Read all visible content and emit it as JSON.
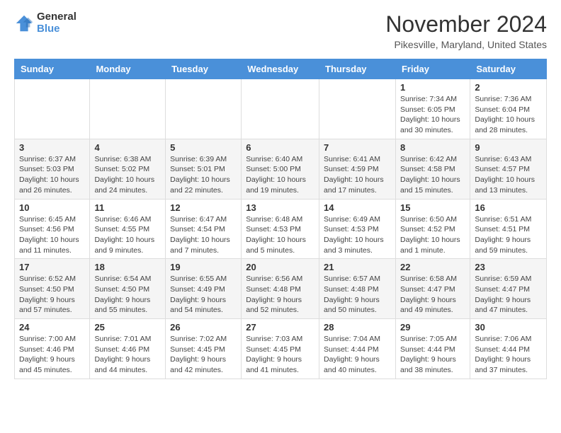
{
  "header": {
    "logo_general": "General",
    "logo_blue": "Blue",
    "month_title": "November 2024",
    "location": "Pikesville, Maryland, United States"
  },
  "days_of_week": [
    "Sunday",
    "Monday",
    "Tuesday",
    "Wednesday",
    "Thursday",
    "Friday",
    "Saturday"
  ],
  "weeks": [
    [
      {
        "day": "",
        "info": ""
      },
      {
        "day": "",
        "info": ""
      },
      {
        "day": "",
        "info": ""
      },
      {
        "day": "",
        "info": ""
      },
      {
        "day": "",
        "info": ""
      },
      {
        "day": "1",
        "info": "Sunrise: 7:34 AM\nSunset: 6:05 PM\nDaylight: 10 hours and 30 minutes."
      },
      {
        "day": "2",
        "info": "Sunrise: 7:36 AM\nSunset: 6:04 PM\nDaylight: 10 hours and 28 minutes."
      }
    ],
    [
      {
        "day": "3",
        "info": "Sunrise: 6:37 AM\nSunset: 5:03 PM\nDaylight: 10 hours and 26 minutes."
      },
      {
        "day": "4",
        "info": "Sunrise: 6:38 AM\nSunset: 5:02 PM\nDaylight: 10 hours and 24 minutes."
      },
      {
        "day": "5",
        "info": "Sunrise: 6:39 AM\nSunset: 5:01 PM\nDaylight: 10 hours and 22 minutes."
      },
      {
        "day": "6",
        "info": "Sunrise: 6:40 AM\nSunset: 5:00 PM\nDaylight: 10 hours and 19 minutes."
      },
      {
        "day": "7",
        "info": "Sunrise: 6:41 AM\nSunset: 4:59 PM\nDaylight: 10 hours and 17 minutes."
      },
      {
        "day": "8",
        "info": "Sunrise: 6:42 AM\nSunset: 4:58 PM\nDaylight: 10 hours and 15 minutes."
      },
      {
        "day": "9",
        "info": "Sunrise: 6:43 AM\nSunset: 4:57 PM\nDaylight: 10 hours and 13 minutes."
      }
    ],
    [
      {
        "day": "10",
        "info": "Sunrise: 6:45 AM\nSunset: 4:56 PM\nDaylight: 10 hours and 11 minutes."
      },
      {
        "day": "11",
        "info": "Sunrise: 6:46 AM\nSunset: 4:55 PM\nDaylight: 10 hours and 9 minutes."
      },
      {
        "day": "12",
        "info": "Sunrise: 6:47 AM\nSunset: 4:54 PM\nDaylight: 10 hours and 7 minutes."
      },
      {
        "day": "13",
        "info": "Sunrise: 6:48 AM\nSunset: 4:53 PM\nDaylight: 10 hours and 5 minutes."
      },
      {
        "day": "14",
        "info": "Sunrise: 6:49 AM\nSunset: 4:53 PM\nDaylight: 10 hours and 3 minutes."
      },
      {
        "day": "15",
        "info": "Sunrise: 6:50 AM\nSunset: 4:52 PM\nDaylight: 10 hours and 1 minute."
      },
      {
        "day": "16",
        "info": "Sunrise: 6:51 AM\nSunset: 4:51 PM\nDaylight: 9 hours and 59 minutes."
      }
    ],
    [
      {
        "day": "17",
        "info": "Sunrise: 6:52 AM\nSunset: 4:50 PM\nDaylight: 9 hours and 57 minutes."
      },
      {
        "day": "18",
        "info": "Sunrise: 6:54 AM\nSunset: 4:50 PM\nDaylight: 9 hours and 55 minutes."
      },
      {
        "day": "19",
        "info": "Sunrise: 6:55 AM\nSunset: 4:49 PM\nDaylight: 9 hours and 54 minutes."
      },
      {
        "day": "20",
        "info": "Sunrise: 6:56 AM\nSunset: 4:48 PM\nDaylight: 9 hours and 52 minutes."
      },
      {
        "day": "21",
        "info": "Sunrise: 6:57 AM\nSunset: 4:48 PM\nDaylight: 9 hours and 50 minutes."
      },
      {
        "day": "22",
        "info": "Sunrise: 6:58 AM\nSunset: 4:47 PM\nDaylight: 9 hours and 49 minutes."
      },
      {
        "day": "23",
        "info": "Sunrise: 6:59 AM\nSunset: 4:47 PM\nDaylight: 9 hours and 47 minutes."
      }
    ],
    [
      {
        "day": "24",
        "info": "Sunrise: 7:00 AM\nSunset: 4:46 PM\nDaylight: 9 hours and 45 minutes."
      },
      {
        "day": "25",
        "info": "Sunrise: 7:01 AM\nSunset: 4:46 PM\nDaylight: 9 hours and 44 minutes."
      },
      {
        "day": "26",
        "info": "Sunrise: 7:02 AM\nSunset: 4:45 PM\nDaylight: 9 hours and 42 minutes."
      },
      {
        "day": "27",
        "info": "Sunrise: 7:03 AM\nSunset: 4:45 PM\nDaylight: 9 hours and 41 minutes."
      },
      {
        "day": "28",
        "info": "Sunrise: 7:04 AM\nSunset: 4:44 PM\nDaylight: 9 hours and 40 minutes."
      },
      {
        "day": "29",
        "info": "Sunrise: 7:05 AM\nSunset: 4:44 PM\nDaylight: 9 hours and 38 minutes."
      },
      {
        "day": "30",
        "info": "Sunrise: 7:06 AM\nSunset: 4:44 PM\nDaylight: 9 hours and 37 minutes."
      }
    ]
  ]
}
